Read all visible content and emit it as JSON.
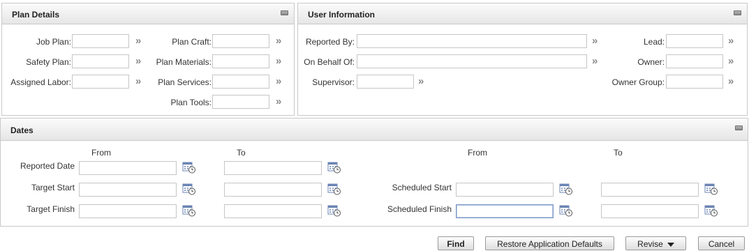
{
  "plan_details": {
    "title": "Plan Details",
    "job_plan_label": "Job Plan:",
    "safety_plan_label": "Safety Plan:",
    "assigned_labor_label": "Assigned Labor:",
    "plan_craft_label": "Plan Craft:",
    "plan_materials_label": "Plan Materials:",
    "plan_services_label": "Plan Services:",
    "plan_tools_label": "Plan Tools:",
    "job_plan_value": "",
    "safety_plan_value": "",
    "assigned_labor_value": "",
    "plan_craft_value": "",
    "plan_materials_value": "",
    "plan_services_value": "",
    "plan_tools_value": ""
  },
  "user_information": {
    "title": "User Information",
    "reported_by_label": "Reported By:",
    "on_behalf_of_label": "On Behalf Of:",
    "supervisor_label": "Supervisor:",
    "lead_label": "Lead:",
    "owner_label": "Owner:",
    "owner_group_label": "Owner Group:",
    "reported_by_value": "",
    "on_behalf_of_value": "",
    "supervisor_value": "",
    "lead_value": "",
    "owner_value": "",
    "owner_group_value": ""
  },
  "dates": {
    "title": "Dates",
    "from_label": "From",
    "to_label": "To",
    "from_label_2": "From",
    "to_label_2": "To",
    "reported_date_label": "Reported Date",
    "target_start_label": "Target Start",
    "target_finish_label": "Target Finish",
    "scheduled_start_label": "Scheduled Start",
    "scheduled_finish_label": "Scheduled Finish",
    "reported_date_from": "",
    "reported_date_to": "",
    "target_start_from": "",
    "target_start_to": "",
    "target_finish_from": "",
    "target_finish_to": "",
    "scheduled_start_from": "",
    "scheduled_start_to": "",
    "scheduled_finish_from": "",
    "scheduled_finish_to": ""
  },
  "icons": {
    "lookup": "double-chevron-right-icon",
    "calendar": "calendar-clock-icon",
    "collapse": "minimize-icon"
  },
  "buttons": {
    "find": "Find",
    "restore_defaults": "Restore Application Defaults",
    "revise": "Revise",
    "cancel": "Cancel"
  },
  "colors": {
    "header_gradient_top": "#fbfbfb",
    "header_gradient_bottom": "#e6e6e6",
    "border": "#c9c9c9",
    "focus_border": "#7d98c4"
  }
}
